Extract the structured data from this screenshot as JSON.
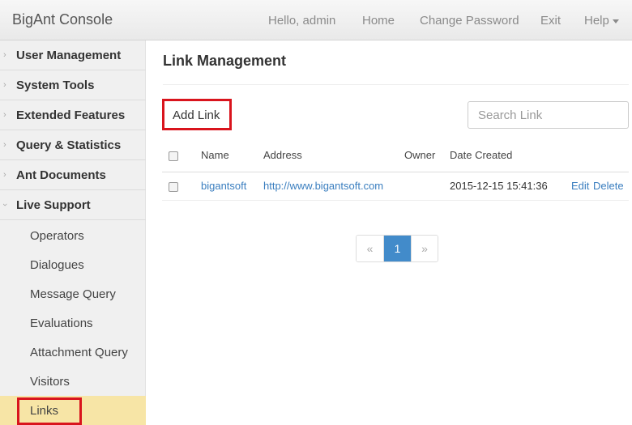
{
  "navbar": {
    "brand": "BigAnt Console",
    "greeting": "Hello, admin",
    "home": "Home",
    "change_password": "Change Password",
    "exit": "Exit",
    "help": "Help"
  },
  "sidebar": {
    "groups": [
      {
        "label": "User Management"
      },
      {
        "label": "System Tools"
      },
      {
        "label": "Extended Features"
      },
      {
        "label": "Query & Statistics"
      },
      {
        "label": "Ant Documents"
      },
      {
        "label": "Live Support"
      }
    ],
    "live_support_items": [
      {
        "label": "Operators"
      },
      {
        "label": "Dialogues"
      },
      {
        "label": "Message Query"
      },
      {
        "label": "Evaluations"
      },
      {
        "label": "Attachment Query"
      },
      {
        "label": "Visitors"
      },
      {
        "label": "Links"
      }
    ]
  },
  "main": {
    "title": "Link Management",
    "add_button": "Add Link",
    "search_placeholder": "Search Link",
    "table": {
      "headers": [
        "Name",
        "Address",
        "Owner",
        "Date Created"
      ],
      "rows": [
        {
          "name": "bigantsoft",
          "address": "http://www.bigantsoft.com",
          "owner": "",
          "date_created": "2015-12-15 15:41:36",
          "edit": "Edit",
          "delete": "Delete"
        }
      ]
    },
    "pagination": {
      "prev": "«",
      "current": "1",
      "next": "»"
    }
  },
  "colors": {
    "accent": "#428bca",
    "link": "#3a7ebf",
    "highlight_box": "#d9141d",
    "active_item_bg": "#f7e5a6"
  }
}
